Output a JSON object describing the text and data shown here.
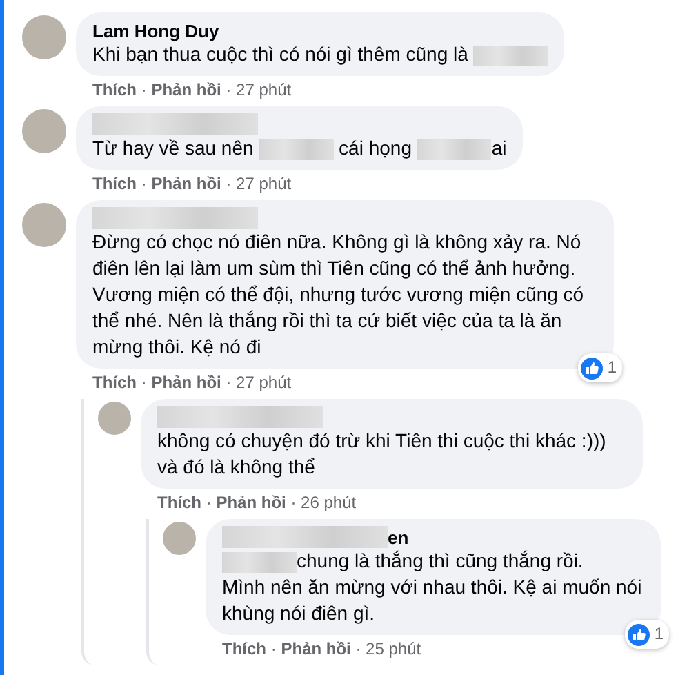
{
  "comments": [
    {
      "header": [
        {
          "kind": "text",
          "text": "Lam Hong Duy"
        }
      ],
      "body": [
        {
          "kind": "text",
          "text": "Khi bạn thua cuộc thì có nói gì thêm cũng là "
        },
        {
          "kind": "blur"
        }
      ],
      "actions": {
        "like": "Thích",
        "reply": "Phản hồi",
        "time": "27 phút",
        "separator": "·"
      }
    },
    {
      "header": [
        {
          "kind": "blur"
        }
      ],
      "body": [
        {
          "kind": "text",
          "text": "Từ hay về sau nên "
        },
        {
          "kind": "blur"
        },
        {
          "kind": "text",
          "text": " cái họng "
        },
        {
          "kind": "blur"
        },
        {
          "kind": "text",
          "text": "ai"
        }
      ],
      "actions": {
        "like": "Thích",
        "reply": "Phản hồi",
        "time": "27 phút",
        "separator": "·"
      }
    },
    {
      "header": [
        {
          "kind": "blur"
        }
      ],
      "body": [
        {
          "kind": "text",
          "text": "Đừng có chọc nó điên nữa. Không gì là không xảy ra. Nó điên lên lại làm um sùm thì Tiên cũng có thể ảnh hưởng. Vương miện có thể đội, nhưng tước vương miện cũng có thể nhé. Nên là thắng rồi thì ta cứ biết việc của ta là ăn mừng thôi. Kệ nó đi"
        }
      ],
      "reaction_count": "1",
      "actions": {
        "like": "Thích",
        "reply": "Phản hồi",
        "time": "27 phút",
        "separator": "·"
      },
      "replies": [
        {
          "header": [
            {
              "kind": "blur"
            }
          ],
          "body": [
            {
              "kind": "text",
              "text": "không có chuyện đó trừ khi Tiên thi cuộc thi khác :))) và đó là không thể"
            }
          ],
          "actions": {
            "like": "Thích",
            "reply": "Phản hồi",
            "time": "26 phút",
            "separator": "·"
          },
          "replies": [
            {
              "header": [
                {
                  "kind": "blur"
                },
                {
                  "kind": "text",
                  "text": "en"
                }
              ],
              "body": [
                {
                  "kind": "blur"
                },
                {
                  "kind": "text",
                  "text": "chung là thắng thì cũng thắng rồi."
                },
                {
                  "kind": "line",
                  "text": "Mình nên ăn mừng với nhau thôi. Kệ ai muốn nói khùng nói điên gì."
                }
              ],
              "reaction_count": "1",
              "actions": {
                "like": "Thích",
                "reply": "Phản hồi",
                "time": "25 phút",
                "separator": "·"
              }
            }
          ]
        }
      ]
    }
  ]
}
